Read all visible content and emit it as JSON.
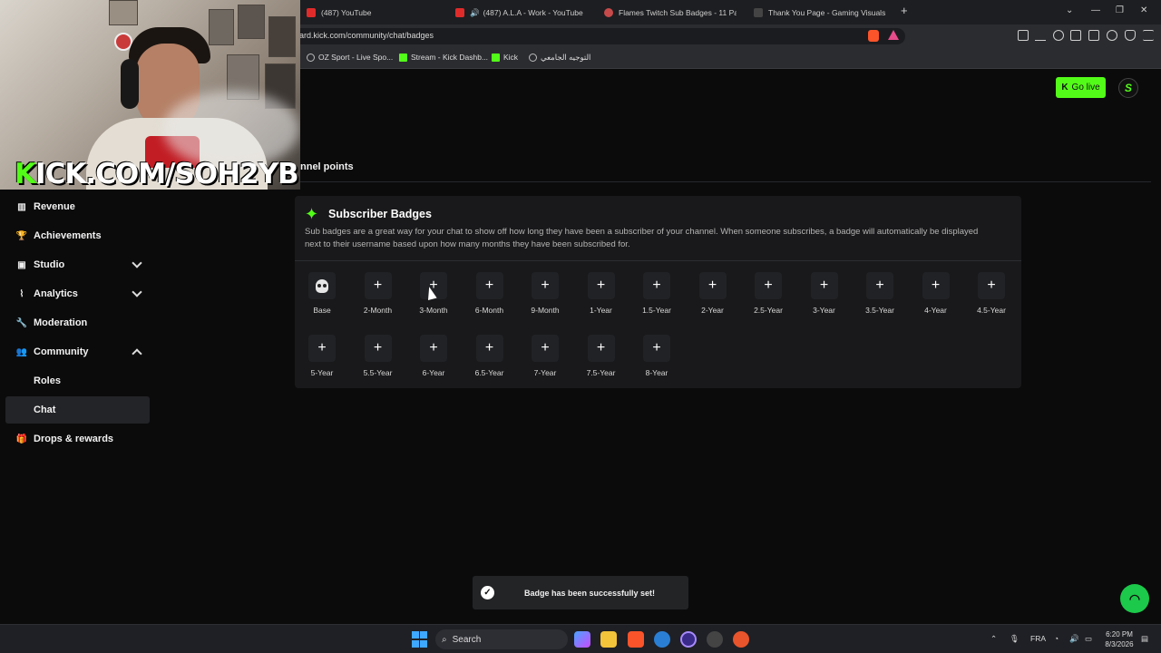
{
  "browser": {
    "tabs": [
      {
        "label": "(487) YouTube",
        "color": "#e02b2b"
      },
      {
        "label": "(487) A.L.A - Work - YouTube",
        "color": "#e02b2b"
      },
      {
        "label": "Flames Twitch Sub Badges - 11 Pack",
        "color": "#c74a4a"
      },
      {
        "label": "Thank You Page - Gaming Visuals",
        "color": "#333"
      }
    ],
    "new_tab": "+",
    "url": "ard.kick.com/community/chat/badges",
    "bookmarks": [
      {
        "label": "OZ Sport - Live Spo...",
        "color": "#bbb"
      },
      {
        "label": "Stream - Kick Dashb...",
        "color": "#53fc18"
      },
      {
        "label": "Kick",
        "color": "#53fc18"
      },
      {
        "label": "التوجيه الجامعي",
        "color": "#bbb"
      }
    ]
  },
  "webcam": {
    "overlay_prefix": "K",
    "overlay_text": "ICK.COM/SOH2YB"
  },
  "header": {
    "go_live": "Go live",
    "go_live_icon": "K",
    "avatar_letter": "S"
  },
  "page": {
    "tab_partial": "nnel points"
  },
  "sidebar": {
    "items": [
      {
        "label": "Revenue",
        "icon": "bar-chart"
      },
      {
        "label": "Achievements",
        "icon": "trophy"
      },
      {
        "label": "Studio",
        "icon": "tv"
      },
      {
        "label": "Analytics",
        "icon": "chart"
      },
      {
        "label": "Moderation",
        "icon": "wrench"
      },
      {
        "label": "Community",
        "icon": "people"
      },
      {
        "label": "Roles"
      },
      {
        "label": "Chat"
      },
      {
        "label": "Drops & rewards",
        "icon": "gift"
      }
    ]
  },
  "badges_card": {
    "title": "Subscriber Badges",
    "description": "Sub badges are a great way for your chat to show off how long they have been a subscriber of your channel. When someone subscribes, a badge will automatically be displayed next to their username based upon how many months they have been subscribed for.",
    "add_symbol": "+",
    "badges": [
      "Base",
      "2-Month",
      "3-Month",
      "6-Month",
      "9-Month",
      "1-Year",
      "1.5-Year",
      "2-Year",
      "2.5-Year",
      "3-Year",
      "3.5-Year",
      "4-Year",
      "4.5-Year",
      "5-Year",
      "5.5-Year",
      "6-Year",
      "6.5-Year",
      "7-Year",
      "7.5-Year",
      "8-Year"
    ]
  },
  "toast": {
    "message": "Badge has been successfully set!",
    "check": "✓"
  },
  "taskbar": {
    "search": "Search",
    "lang": "FRA",
    "time": "6:20 PM",
    "date": "8/3/2026"
  },
  "colors": {
    "accent": "#53fc18",
    "background": "#0b0b0c",
    "card": "#19191b"
  }
}
